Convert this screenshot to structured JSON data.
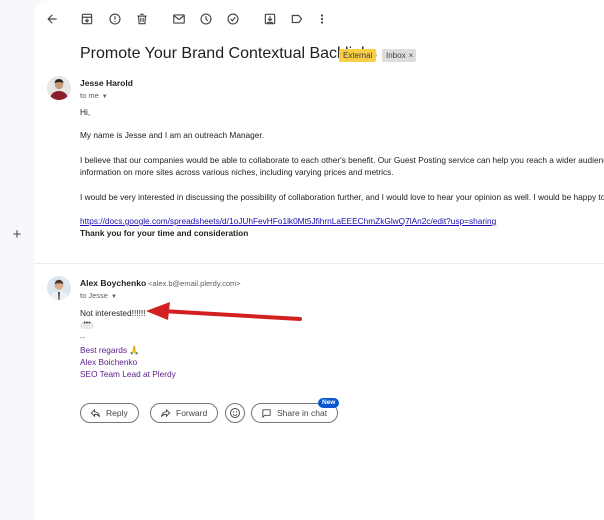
{
  "toolbar": {
    "icons": [
      "back-arrow-icon",
      "archive-icon",
      "report-spam-icon",
      "delete-icon",
      "mark-unread-icon",
      "snooze-icon",
      "add-task-icon",
      "move-to-icon",
      "label-icon",
      "more-vert-icon"
    ]
  },
  "thread": {
    "subject": "Promote Your Brand Contextual Backlinks",
    "labels": {
      "external": "External",
      "inbox": "Inbox",
      "inbox_remove": "×"
    }
  },
  "message1": {
    "sender": "Jesse Harold",
    "recipient": "to me",
    "greeting": "Hi,",
    "p1": "My name is Jesse and I am an outreach Manager.",
    "p2a": "I believe that our companies would be able to collaborate to each other's benefit. Our Guest Posting service can help you reach a wider audience, w",
    "p2b": "information on more sites across various niches, including varying prices and metrics.",
    "p3": "I would be very interested in discussing the possibility of collaboration further, and I would love to hear your opinion as well. I would be happy to sc",
    "link": "https://docs.google.com/spreadsheets/d/1oJUhFevHFo1lk0Mt5JfihrnLaEEEChmZkGlwQ7lAn2c/edit?usp=sharing",
    "closing": "Thank you for your time and consideration"
  },
  "message2": {
    "sender": "Alex Boychenko",
    "email": "<alex.b@email.plerdy.com>",
    "recipient": "to Jesse",
    "text": "Not interested!!!!!!",
    "dots": "•••",
    "dash": "--",
    "sig1": "Best regards 🙏",
    "sig2": "Alex Boichenko",
    "sig3": "SEO Team Lead at Plerdy"
  },
  "actions": {
    "reply": "Reply",
    "forward": "Forward",
    "share": "Share in chat",
    "new_badge": "New"
  },
  "colors": {
    "accent_arrow": "#d21f1f",
    "external_label": "#f7ce46",
    "link": "#1a0dab",
    "signature": "#5b1c8a"
  }
}
